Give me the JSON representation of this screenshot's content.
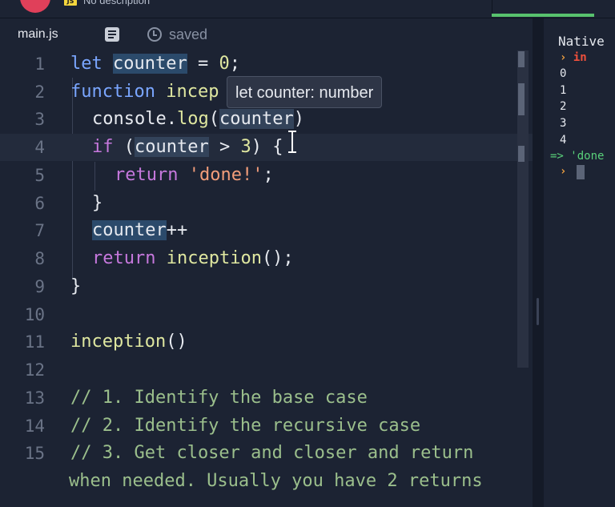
{
  "header": {
    "js_badge": "JS",
    "description": "No description"
  },
  "tabs": {
    "file_name": "main.js",
    "saved_label": "saved"
  },
  "editor": {
    "line_numbers": [
      "1",
      "2",
      "3",
      "4",
      "5",
      "6",
      "7",
      "8",
      "9",
      "10",
      "11",
      "12",
      "13",
      "14",
      "15"
    ],
    "lines": {
      "l1": {
        "kw": "let",
        "ident": "counter",
        "rest": " = ",
        "num": "0",
        "end": ";"
      },
      "l2": {
        "kw": "function",
        "fn": " incep"
      },
      "l3": {
        "obj": "console.",
        "fn": "log",
        "open": "(",
        "ident": "counter",
        "close": ")"
      },
      "l4": {
        "kw": "if",
        "open": " (",
        "ident": "counter",
        "rest": " > ",
        "num": "3",
        "close": ") {"
      },
      "l5": {
        "kw": "return",
        "str": " 'done!'",
        "end": ";"
      },
      "l6": {
        "text": "}"
      },
      "l7": {
        "ident": "counter",
        "rest": "++"
      },
      "l8": {
        "kw": "return",
        "fn": " inception",
        "end": "();"
      },
      "l9": {
        "text": "}"
      },
      "l11": {
        "fn": "inception",
        "end": "()"
      },
      "l13": {
        "text": "// 1. Identify the base case"
      },
      "l14": {
        "text": "// 2. Identify the recursive case"
      },
      "l15": {
        "text": "// 3. Get closer and closer and return"
      },
      "l15b": {
        "text": "when needed. Usually you have 2 returns"
      }
    },
    "tooltip": "let counter: number"
  },
  "console": {
    "title": "Native",
    "prompt_symbol": "›",
    "input_keyword": "in",
    "outputs": [
      "0",
      "1",
      "2",
      "3",
      "4"
    ],
    "return_arrow": "=>",
    "return_value": "'done"
  }
}
